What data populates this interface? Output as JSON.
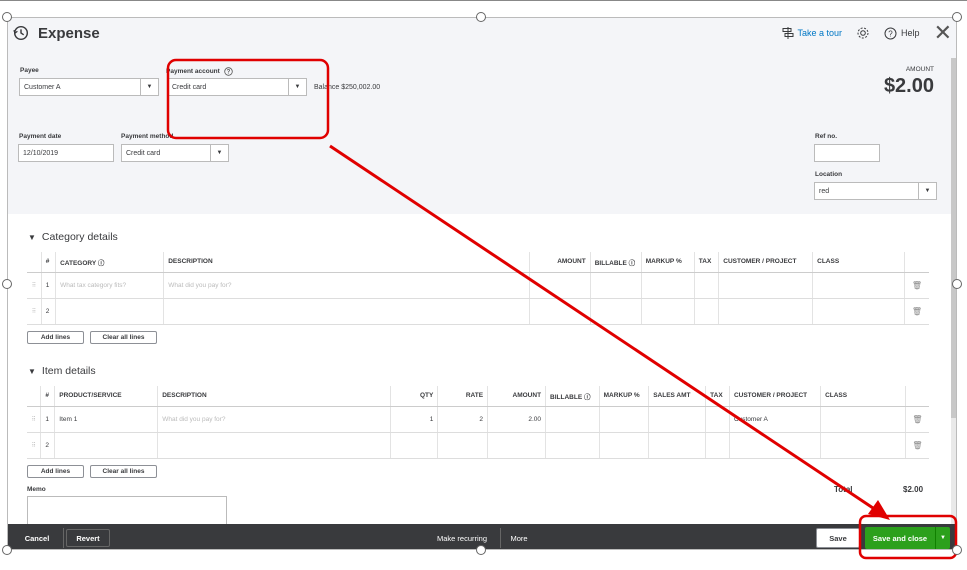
{
  "header": {
    "title": "Expense",
    "take_tour": "Take a tour",
    "help": "Help"
  },
  "payee": {
    "label": "Payee",
    "value": "Customer A"
  },
  "payment_account": {
    "label": "Payment account",
    "value": "Credit card"
  },
  "balance": {
    "label": "Balance",
    "value": "$250,002.00"
  },
  "amount": {
    "label": "AMOUNT",
    "value": "$2.00"
  },
  "payment_date": {
    "label": "Payment date",
    "value": "12/10/2019"
  },
  "payment_method": {
    "label": "Payment method",
    "value": "Credit card"
  },
  "ref_no": {
    "label": "Ref no.",
    "value": ""
  },
  "location": {
    "label": "Location",
    "value": "red"
  },
  "category_details": {
    "title": "Category details",
    "headers": [
      "#",
      "CATEGORY",
      "DESCRIPTION",
      "AMOUNT",
      "BILLABLE",
      "MARKUP %",
      "TAX",
      "CUSTOMER / PROJECT",
      "CLASS"
    ],
    "rows": [
      {
        "num": "1",
        "category_placeholder": "What tax category fits?",
        "description_placeholder": "What did you pay for?"
      },
      {
        "num": "2"
      }
    ],
    "add_lines": "Add lines",
    "clear_lines": "Clear all lines"
  },
  "item_details": {
    "title": "Item details",
    "headers": [
      "#",
      "PRODUCT/SERVICE",
      "DESCRIPTION",
      "QTY",
      "RATE",
      "AMOUNT",
      "BILLABLE",
      "MARKUP %",
      "SALES AMT",
      "TAX",
      "CUSTOMER / PROJECT",
      "CLASS"
    ],
    "rows": [
      {
        "num": "1",
        "product": "Item 1",
        "description_placeholder": "What did you pay for?",
        "qty": "1",
        "rate": "2",
        "amount": "2.00",
        "customer": "Customer A"
      },
      {
        "num": "2"
      }
    ],
    "add_lines": "Add lines",
    "clear_lines": "Clear all lines"
  },
  "memo": {
    "label": "Memo"
  },
  "total": {
    "label": "Total",
    "value": "$2.00"
  },
  "footer": {
    "cancel": "Cancel",
    "revert": "Revert",
    "make_recurring": "Make recurring",
    "more": "More",
    "save": "Save",
    "save_and_close": "Save and close"
  },
  "colors": {
    "accent_green": "#2ca01c",
    "link_blue": "#0077c5",
    "annotation_red": "#e00000",
    "footer_dark": "#393a3d"
  }
}
